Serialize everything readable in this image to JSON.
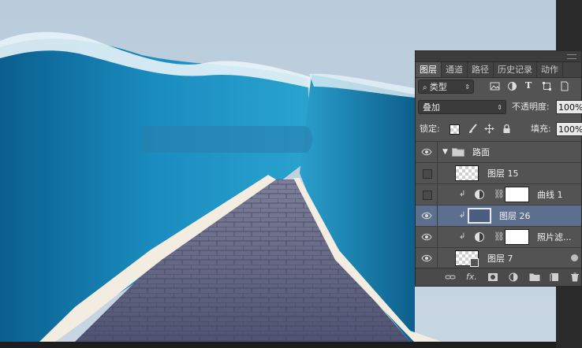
{
  "canvas": {
    "description_icon": "canvas-image"
  },
  "panel": {
    "tabs": [
      {
        "label": "图层",
        "active": true
      },
      {
        "label": "通道",
        "active": false
      },
      {
        "label": "路径",
        "active": false
      },
      {
        "label": "历史记录",
        "active": false
      },
      {
        "label": "动作",
        "active": false
      }
    ],
    "filter": {
      "value": "类型"
    },
    "blend_mode": {
      "value": "叠加"
    },
    "opacity": {
      "label": "不透明度:",
      "value": "100%"
    },
    "lock": {
      "label": "锁定:"
    },
    "fill": {
      "label": "填充:",
      "value": "100%"
    },
    "layers": [
      {
        "name": "路面",
        "type": "group",
        "visible": true
      },
      {
        "name": "图层 15",
        "type": "pixel",
        "visible": false
      },
      {
        "name": "曲线 1",
        "type": "curves-adjustment",
        "visible": false,
        "clipped": true
      },
      {
        "name": "图层 26",
        "type": "pixel",
        "visible": true,
        "clipped": true,
        "selected": true,
        "fill_color": "#4a5d80"
      },
      {
        "name": "照片滤...",
        "type": "photo-filter-adjustment",
        "visible": true,
        "clipped": true
      },
      {
        "name": "图层 7",
        "type": "smart-object",
        "visible": true
      }
    ]
  },
  "colors": {
    "panel_bg": "#535353",
    "selected_row": "#5d6f8f",
    "sky": "#b7cbdb",
    "water": "#1a7fb0"
  }
}
